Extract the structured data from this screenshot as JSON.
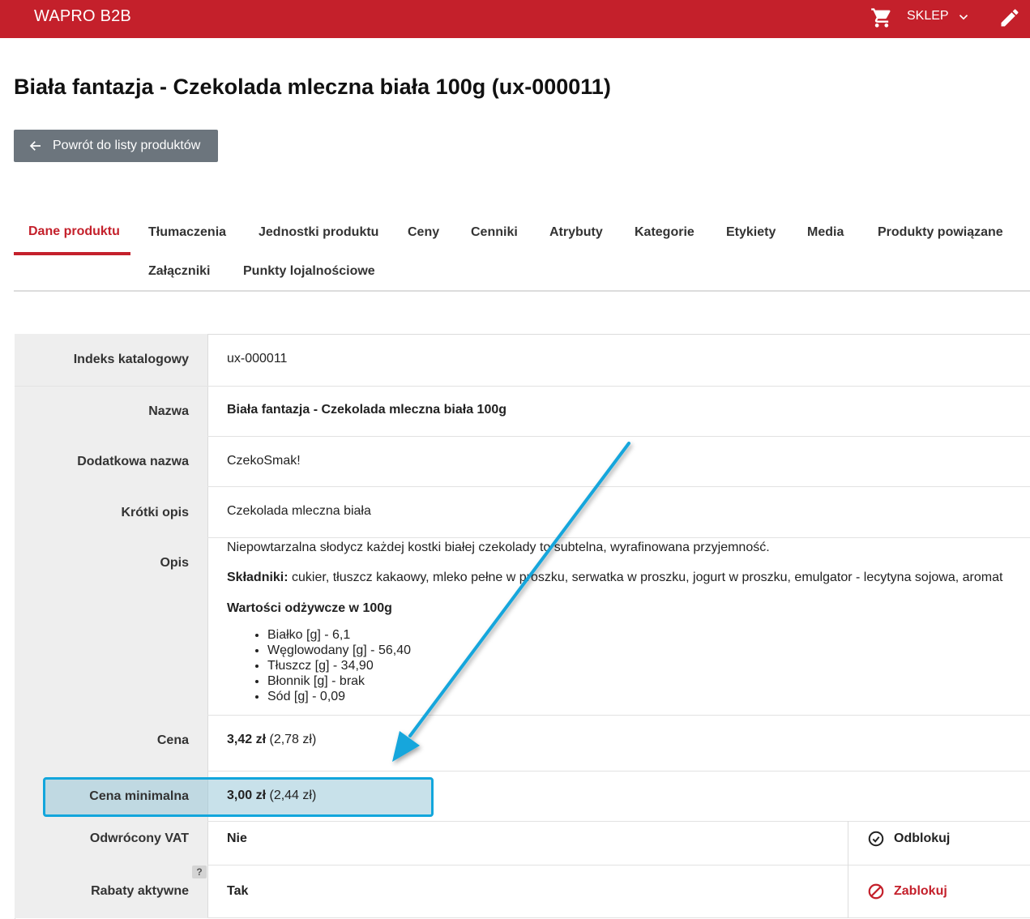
{
  "header": {
    "brand": "WAPRO B2B",
    "shop_label": "SKLEP",
    "icons": [
      "cart-icon",
      "chevron-down-icon",
      "pencil-icon"
    ]
  },
  "page_title": "Biała fantazja - Czekolada mleczna biała 100g (ux-000011)",
  "back_button": "Powrót do listy produktów",
  "tabs": [
    "Dane produktu",
    "Tłumaczenia",
    "Jednostki produktu",
    "Ceny",
    "Cenniki",
    "Atrybuty",
    "Kategorie",
    "Etykiety",
    "Media",
    "Produkty powiązane",
    "Załączniki",
    "Punkty lojalnościowe"
  ],
  "active_tab": "Dane produktu",
  "rows": {
    "catalog_index": {
      "label": "Indeks katalogowy",
      "value": "ux-000011"
    },
    "name": {
      "label": "Nazwa",
      "value": "Biała fantazja - Czekolada mleczna biała 100g"
    },
    "extra_name": {
      "label": "Dodatkowa nazwa",
      "value": "CzekoSmak!"
    },
    "short_desc": {
      "label": "Krótki opis",
      "value": "Czekolada mleczna biała"
    },
    "description": {
      "label": "Opis",
      "intro": "Niepowtarzalna słodycz każdej kostki białej czekolady to subtelna, wyrafinowana przyjemność.",
      "ingredients_label": "Składniki:",
      "ingredients": "cukier, tłuszcz kakaowy, mleko pełne w proszku, serwatka w proszku, jogurt w proszku, emulgator - lecytyna sojowa, aromat",
      "nutrition_title": "Wartości odżywcze w 100g",
      "nutrition": [
        "Białko [g] - 6,1",
        "Węglowodany [g] - 56,40",
        "Tłuszcz [g] - 34,90",
        "Błonnik [g] - brak",
        "Sód [g] - 0,09"
      ]
    },
    "price": {
      "label": "Cena",
      "gross": "3,42 zł",
      "net": "(2,78 zł)"
    },
    "min_price": {
      "label": "Cena minimalna",
      "gross": "3,00 zł",
      "net": "(2,44 zł)"
    },
    "reverse_vat": {
      "label": "Odwrócony VAT",
      "value": "Nie",
      "action": "Odblokuj"
    },
    "discounts": {
      "label": "Rabaty aktywne",
      "value": "Tak",
      "action": "Zablokuj",
      "help": "?"
    }
  },
  "colors": {
    "brand_red": "#c4202b",
    "button_gray": "#6c757d",
    "highlight_blue": "#12a6dc"
  }
}
